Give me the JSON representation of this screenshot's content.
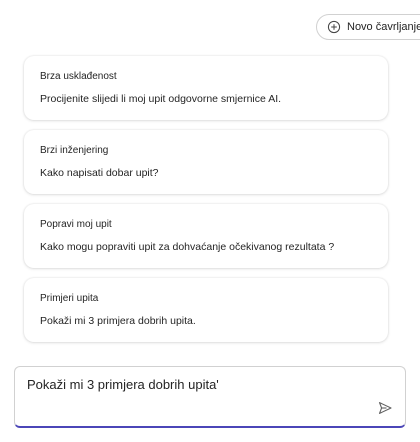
{
  "header": {
    "new_chat_label": "Novo čavrljanje"
  },
  "prompts": [
    {
      "title": "Brza usklađenost",
      "text": "Procijenite slijedi li moj upit odgovorne smjernice AI."
    },
    {
      "title": "Brzi inženjering",
      "text": "Kako napisati dobar upit?"
    },
    {
      "title": "Popravi moj upit",
      "text": "Kako mogu popraviti upit za dohvaćanje očekivanog rezultata ?"
    },
    {
      "title": "Primjeri upita",
      "text": "Pokaži mi 3 primjera dobrih upita."
    }
  ],
  "composer": {
    "value": "Pokaži mi 3 primjera dobrih upita'"
  },
  "colors": {
    "accent": "#4b46b8",
    "border": "#d1d1d1"
  },
  "icons": {
    "new_chat": "plus-circle-icon",
    "send": "send-icon"
  }
}
